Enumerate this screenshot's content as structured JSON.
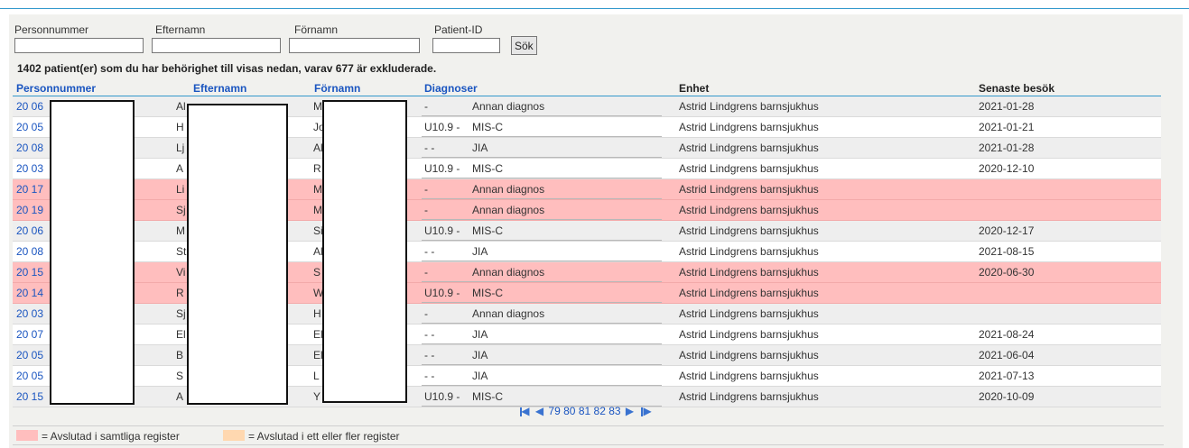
{
  "search": {
    "fields": [
      {
        "label": "Personnummer",
        "value": ""
      },
      {
        "label": "Efternamn",
        "value": ""
      },
      {
        "label": "Förnamn",
        "value": ""
      },
      {
        "label": "Patient-ID",
        "value": ""
      }
    ],
    "submit_label": "Sök"
  },
  "info_text": "1402 patient(er) som du har behörighet till visas nedan, varav 677 är exkluderade.",
  "table": {
    "headers": {
      "pnr": "Personnummer",
      "efternamn": "Efternamn",
      "fornamn": "Förnamn",
      "diagnoser": "Diagnoser",
      "enhet": "Enhet",
      "senaste": "Senaste besök"
    },
    "rows": [
      {
        "pnr": "20 06",
        "efternamn": "Al",
        "fornamn": "M",
        "diag_code": "-",
        "diag_name": "Annan diagnos",
        "enhet": "Astrid Lindgrens barnsjukhus",
        "senaste": "2021-01-28",
        "status": "normal"
      },
      {
        "pnr": "20 05",
        "efternamn": "H",
        "fornamn": "Jo",
        "diag_code": "U10.9 -",
        "diag_name": "MIS-C",
        "enhet": "Astrid Lindgrens barnsjukhus",
        "senaste": "2021-01-21",
        "status": "normal"
      },
      {
        "pnr": "20 08",
        "efternamn": "Lj",
        "fornamn": "Al",
        "diag_code": "- -",
        "diag_name": "JIA",
        "enhet": "Astrid Lindgrens barnsjukhus",
        "senaste": "2021-01-28",
        "status": "normal"
      },
      {
        "pnr": "20 03",
        "efternamn": "A",
        "fornamn": "R",
        "diag_code": "U10.9 -",
        "diag_name": "MIS-C",
        "enhet": "Astrid Lindgrens barnsjukhus",
        "senaste": "2020-12-10",
        "status": "normal"
      },
      {
        "pnr": "20 17",
        "efternamn": "Li",
        "fornamn": "M",
        "diag_code": "-",
        "diag_name": "Annan diagnos",
        "enhet": "Astrid Lindgrens barnsjukhus",
        "senaste": "",
        "status": "closed"
      },
      {
        "pnr": "20 19",
        "efternamn": "Sj",
        "fornamn": "M",
        "diag_code": "-",
        "diag_name": "Annan diagnos",
        "enhet": "Astrid Lindgrens barnsjukhus",
        "senaste": "",
        "status": "closed"
      },
      {
        "pnr": "20 06",
        "efternamn": "M",
        "fornamn": "Si",
        "diag_code": "U10.9 -",
        "diag_name": "MIS-C",
        "enhet": "Astrid Lindgrens barnsjukhus",
        "senaste": "2020-12-17",
        "status": "normal"
      },
      {
        "pnr": "20 08",
        "efternamn": "St",
        "fornamn": "Al",
        "diag_code": "- -",
        "diag_name": "JIA",
        "enhet": "Astrid Lindgrens barnsjukhus",
        "senaste": "2021-08-15",
        "status": "normal"
      },
      {
        "pnr": "20 15",
        "efternamn": "Vi",
        "fornamn": "S",
        "diag_code": "-",
        "diag_name": "Annan diagnos",
        "enhet": "Astrid Lindgrens barnsjukhus",
        "senaste": "2020-06-30",
        "status": "closed"
      },
      {
        "pnr": "20 14",
        "efternamn": "R",
        "fornamn": "W",
        "diag_code": "U10.9 -",
        "diag_name": "MIS-C",
        "enhet": "Astrid Lindgrens barnsjukhus",
        "senaste": "",
        "status": "closed"
      },
      {
        "pnr": "20 03",
        "efternamn": "Sj",
        "fornamn": "H",
        "diag_code": "-",
        "diag_name": "Annan diagnos",
        "enhet": "Astrid Lindgrens barnsjukhus",
        "senaste": "",
        "status": "normal"
      },
      {
        "pnr": "20 07",
        "efternamn": "El",
        "fornamn": "El",
        "diag_code": "- -",
        "diag_name": "JIA",
        "enhet": "Astrid Lindgrens barnsjukhus",
        "senaste": "2021-08-24",
        "status": "normal"
      },
      {
        "pnr": "20 05",
        "efternamn": "B",
        "fornamn": "El",
        "diag_code": "- -",
        "diag_name": "JIA",
        "enhet": "Astrid Lindgrens barnsjukhus",
        "senaste": "2021-06-04",
        "status": "normal"
      },
      {
        "pnr": "20 05",
        "efternamn": "S",
        "fornamn": "L",
        "diag_code": "- -",
        "diag_name": "JIA",
        "enhet": "Astrid Lindgrens barnsjukhus",
        "senaste": "2021-07-13",
        "status": "normal"
      },
      {
        "pnr": "20 15",
        "efternamn": "A",
        "fornamn": "Y",
        "diag_code": "U10.9 -",
        "diag_name": "MIS-C",
        "enhet": "Astrid Lindgrens barnsjukhus",
        "senaste": "2020-10-09",
        "status": "normal"
      }
    ]
  },
  "pager": {
    "pages": [
      "79",
      "80",
      "81",
      "82",
      "83"
    ],
    "first_icon": "first-page-icon",
    "prev_icon": "prev-page-icon",
    "next_icon": "next-page-icon",
    "last_icon": "last-page-icon"
  },
  "legend": {
    "items": [
      {
        "label": "= Avslutad i samtliga register",
        "color": "#ffbebe"
      },
      {
        "label": "= Avslutad i ett eller fler register",
        "color": "#ffd8b0"
      }
    ]
  },
  "colors": {
    "link": "#1a55c0",
    "accent": "#3399cc",
    "closed_row": "#ffbebe",
    "row_alt": "#eeeeee"
  }
}
